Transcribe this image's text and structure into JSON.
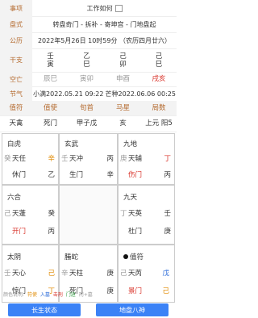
{
  "header": {
    "label": "事项",
    "value": "工作如何"
  },
  "pan": {
    "label": "盘式",
    "value": "转盘奇门 - 拆补 - 寄坤宫 - 门地盘起"
  },
  "gongli": {
    "label": "公历",
    "value": "2022年5月26日 10时59分 （农历四月廿六）"
  },
  "ganzhi": {
    "label": "干支",
    "cols": [
      {
        "top": "壬",
        "bottom": "寅"
      },
      {
        "top": "乙",
        "bottom": "巳"
      },
      {
        "top": "己",
        "bottom": "卯"
      },
      {
        "top": "己",
        "bottom": "巳"
      }
    ]
  },
  "kongwang": {
    "label": "空亡",
    "values": [
      "辰巳",
      "寅卯",
      "申酉",
      "戌亥"
    ],
    "colors": [
      "#999999",
      "#999999",
      "#999999",
      "#d9342b"
    ]
  },
  "jieqi": {
    "label": "节气",
    "values": [
      "小满2022.05.21 09:22",
      "芒种2022.06.06 00:25"
    ]
  },
  "info_headers": [
    "值符",
    "值使",
    "旬首",
    "马星",
    "局数"
  ],
  "info_values": [
    "天禽",
    "死门",
    "甲子戊",
    "亥",
    "上元 阳5"
  ],
  "palaces": [
    {
      "name": "白虎",
      "star": "天任",
      "stem_a": "辛",
      "gate": "休门",
      "stem_b": "乙",
      "left_mark": "癸"
    },
    {
      "name": "玄武",
      "star": "天冲",
      "stem_a": "丙",
      "gate": "生门",
      "stem_b": "辛",
      "left_mark": "壬"
    },
    {
      "name": "九地",
      "star": "天辅",
      "stem_a": "丁",
      "gate": "伤门",
      "stem_b": "丙",
      "left_mark": "庚"
    },
    {
      "name": "六合",
      "star": "天蓬",
      "stem_a": "癸",
      "gate": "开门",
      "stem_b": "丙",
      "left_mark": "己"
    },
    {
      "name": "九天",
      "star": "天英",
      "stem_a": "壬",
      "gate": "杜门",
      "stem_b": "庚",
      "left_mark": "丁"
    },
    {
      "name": "太阴",
      "star": "天心",
      "stem_a": "己",
      "gate": "惊门",
      "stem_b": "丁",
      "left_mark": "壬"
    },
    {
      "name": "螣蛇",
      "star": "天柱",
      "stem_a": "庚",
      "gate": "死门",
      "stem_b": "庚",
      "left_mark": "辛"
    },
    {
      "name": "值符",
      "star": "天芮",
      "stem_a": "戊",
      "gate": "景门",
      "stem_b": "己",
      "left_mark": "己"
    }
  ],
  "legend": {
    "prefix": "颜色说明:",
    "items": [
      "符使",
      "入墓",
      "击刑",
      "门迫",
      "刑+墓"
    ]
  },
  "buttons": {
    "left": "长生状态",
    "right": "地盘八神"
  }
}
